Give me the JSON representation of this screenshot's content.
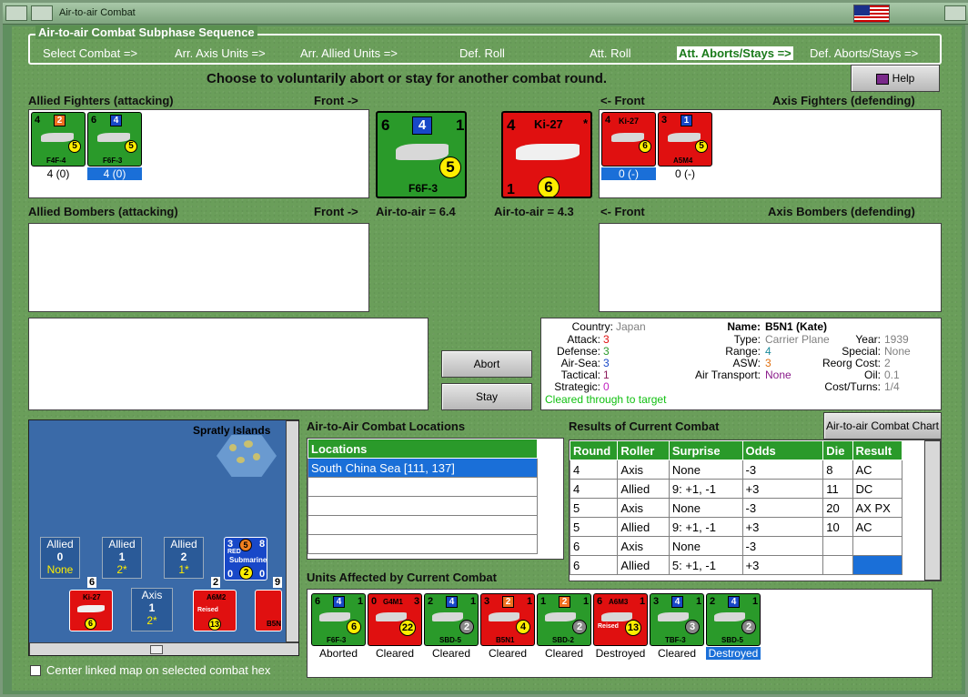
{
  "window": {
    "title": "Air-to-air Combat"
  },
  "phase": {
    "legend": "Air-to-air Combat Subphase Sequence",
    "steps": [
      {
        "label": "Select Combat =>",
        "active": false
      },
      {
        "label": "Arr. Axis Units =>",
        "active": false
      },
      {
        "label": "Arr. Allied Units =>",
        "active": false
      },
      {
        "label": "Def. Roll",
        "active": false
      },
      {
        "label": "Att. Roll",
        "active": false
      },
      {
        "label": "Att. Aborts/Stays =>",
        "active": true
      },
      {
        "label": "Def. Aborts/Stays =>",
        "active": false
      }
    ]
  },
  "instruction": "Choose to voluntarily abort or stay for another combat round.",
  "help_label": "Help",
  "allied_fighters": {
    "label": "Allied Fighters (attacking)",
    "front": "Front ->",
    "units": [
      {
        "name": "F4F-4",
        "attack": "4",
        "defense": "2",
        "range": "5",
        "caption": "4 (0)",
        "selected": false
      },
      {
        "name": "F6F-3",
        "attack": "6",
        "defense": "4",
        "range": "5",
        "caption": "4 (0)",
        "selected": true
      }
    ]
  },
  "axis_fighters": {
    "label": "Axis Fighters (defending)",
    "front": "<- Front",
    "units": [
      {
        "name": "Ki-27",
        "attack": "4",
        "defense": "",
        "range": "6",
        "caption": "0 (-)",
        "selected": true
      },
      {
        "name": "A5M4",
        "attack": "3",
        "defense": "1",
        "range": "5",
        "caption": "0 (-)",
        "selected": false
      }
    ]
  },
  "big_allied": {
    "name": "F6F-3",
    "attack": "6",
    "defense": "4",
    "right": "1",
    "range": "5",
    "air_to_air": "Air-to-air = 6.4"
  },
  "big_axis": {
    "name": "Ki-27",
    "attack": "4",
    "right": "*",
    "bottom": "1",
    "range": "6",
    "air_to_air": "Air-to-air = 4.3"
  },
  "allied_bombers": {
    "label": "Allied Bombers (attacking)",
    "front": "Front ->"
  },
  "axis_bombers": {
    "label": "Axis Bombers (defending)",
    "front": "<- Front"
  },
  "buttons": {
    "abort": "Abort",
    "stay": "Stay",
    "chart": "Air-to-air Combat Chart"
  },
  "unit_info": {
    "country_label": "Country:",
    "country": "Japan",
    "attack_label": "Attack:",
    "attack": "3",
    "defense_label": "Defense:",
    "defense": "3",
    "airsea_label": "Air-Sea:",
    "airsea": "3",
    "tactical_label": "Tactical:",
    "tactical": "1",
    "strategic_label": "Strategic:",
    "strategic": "0",
    "cleared": "Cleared through to target",
    "name_label": "Name:",
    "name": "B5N1 (Kate)",
    "type_label": "Type:",
    "type": "Carrier Plane",
    "year_label": "Year:",
    "year": "1939",
    "range_label": "Range:",
    "range": "4",
    "special_label": "Special:",
    "special": "None",
    "asw_label": "ASW:",
    "asw": "3",
    "reorg_label": "Reorg Cost:",
    "reorg": "2",
    "transport_label": "Air Transport:",
    "transport": "None",
    "oil_label": "Oil:",
    "oil": "0.1",
    "cost_label": "Cost/Turns:",
    "cost": "1/4"
  },
  "map": {
    "region": "Spratly Islands",
    "boxes": [
      {
        "title": "Allied",
        "num": "0",
        "sub": "None"
      },
      {
        "title": "Allied",
        "num": "1",
        "sub": "2*"
      },
      {
        "title": "Allied",
        "num": "2",
        "sub": "1*"
      },
      {
        "title": "Axis",
        "num": "1",
        "sub": "2*"
      }
    ],
    "sub_counter": {
      "left": "3",
      "mid": "5",
      "right": "8",
      "line1": "RED",
      "line2": "Submarine",
      "bl": "0",
      "circle": "2",
      "br": "0"
    },
    "stack_counts": [
      "6",
      "2",
      "9"
    ],
    "map_units": [
      {
        "name": "Ki-27",
        "range": "6"
      },
      {
        "name": "A6M2",
        "line2": "Reised",
        "range": "13"
      },
      {
        "name": "B5N"
      }
    ],
    "center_label": "Center linked map on selected combat hex"
  },
  "locations": {
    "title": "Air-to-Air Combat Locations",
    "header": "Locations",
    "rows": [
      "South China Sea [111, 137]",
      "",
      "",
      "",
      ""
    ]
  },
  "results": {
    "title": "Results of Current Combat",
    "headers": [
      "Round",
      "Roller",
      "Surprise",
      "Odds",
      "Die",
      "Result"
    ],
    "rows": [
      [
        "4",
        "Axis",
        "None",
        "-3",
        "8",
        "AC"
      ],
      [
        "4",
        "Allied",
        "9: +1, -1",
        "+3",
        "11",
        "DC"
      ],
      [
        "5",
        "Axis",
        "None",
        "-3",
        "20",
        "AX PX"
      ],
      [
        "5",
        "Allied",
        "9: +1, -1",
        "+3",
        "10",
        "AC"
      ],
      [
        "6",
        "Axis",
        "None",
        "-3",
        "",
        ""
      ],
      [
        "6",
        "Allied",
        "5: +1, -1",
        "+3",
        "",
        ""
      ]
    ]
  },
  "affected": {
    "title": "Units Affected by Current Combat",
    "units": [
      {
        "name": "F6F-3",
        "color": "green",
        "tl": "6",
        "sq": "4",
        "tr": "1",
        "circle": "6",
        "caption": "Aborted",
        "selected": false
      },
      {
        "name": "G4M1",
        "color": "red",
        "tl": "0",
        "sq": "",
        "tr": "3",
        "circle": "22",
        "caption": "Cleared",
        "selected": false
      },
      {
        "name": "SBD-5",
        "color": "green",
        "tl": "2",
        "sq": "4",
        "tr": "1",
        "circle": "2",
        "caption": "Cleared",
        "selected": false
      },
      {
        "name": "B5N1",
        "color": "red",
        "tl": "3",
        "sq": "2",
        "tr": "1",
        "circle": "4",
        "caption": "Cleared",
        "selected": false
      },
      {
        "name": "SBD-2",
        "color": "green",
        "tl": "1",
        "sq": "2",
        "tr": "1",
        "circle": "2",
        "caption": "Cleared",
        "selected": false
      },
      {
        "name": "A6M3",
        "line2": "Reised",
        "color": "red",
        "tl": "6",
        "sq": "",
        "tr": "1",
        "circle": "13",
        "caption": "Destroyed",
        "selected": false
      },
      {
        "name": "TBF-3",
        "color": "green",
        "tl": "3",
        "sq": "4",
        "tr": "1",
        "circle": "3",
        "caption": "Cleared",
        "selected": false
      },
      {
        "name": "SBD-5",
        "color": "green",
        "tl": "2",
        "sq": "4",
        "tr": "1",
        "circle": "2",
        "caption": "Destroyed",
        "selected": true
      }
    ]
  },
  "colors": {
    "green": "#2a9a2a",
    "red": "#e01010",
    "select": "#1a6fd8"
  }
}
